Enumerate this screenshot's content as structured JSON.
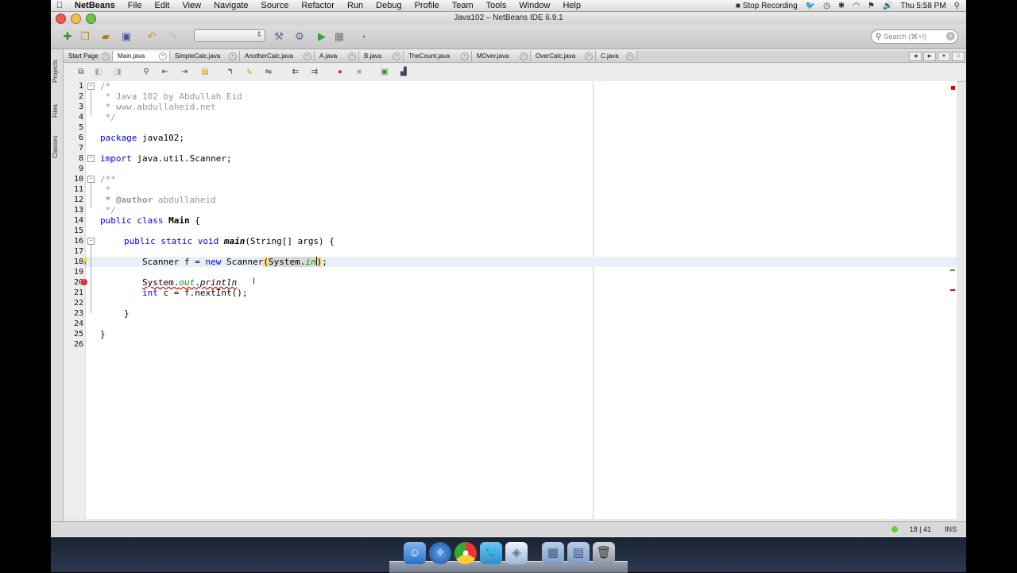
{
  "menubar": {
    "app_name": "NetBeans",
    "items": [
      "File",
      "Edit",
      "View",
      "Navigate",
      "Source",
      "Refactor",
      "Run",
      "Debug",
      "Profile",
      "Team",
      "Tools",
      "Window",
      "Help"
    ],
    "right": {
      "recording": "Stop Recording",
      "clock": "Thu 5:58 PM"
    }
  },
  "window": {
    "title": "Java102 – NetBeans IDE 6.9.1",
    "search_placeholder": "Search (⌘+I)"
  },
  "side_tabs": [
    "Projects",
    "Files",
    "Classes"
  ],
  "tabs": [
    {
      "label": "Start Page",
      "active": false
    },
    {
      "label": "Main.java",
      "active": true
    },
    {
      "label": "SimpleCalc.java",
      "active": false
    },
    {
      "label": "AnotherCalc.java",
      "active": false
    },
    {
      "label": "A.java",
      "active": false
    },
    {
      "label": "B.java",
      "active": false
    },
    {
      "label": "TheCount.java",
      "active": false
    },
    {
      "label": "MOver.java",
      "active": false
    },
    {
      "label": "OverCalc.java",
      "active": false
    },
    {
      "label": "C.java",
      "active": false
    }
  ],
  "code": {
    "line_numbers": [
      "1",
      "2",
      "3",
      "4",
      "5",
      "6",
      "7",
      "8",
      "9",
      "10",
      "11",
      "12",
      "13",
      "14",
      "15",
      "16",
      "17",
      "18",
      "19",
      "20",
      "21",
      "22",
      "23",
      "24",
      "25",
      "26"
    ],
    "l1": "/*",
    "l2": " * Java 102 by Abdullah Eid",
    "l3": " * www.abdullaheid.net",
    "l4": " */",
    "l6_kw": "package",
    "l6_rest": " java102;",
    "l8_kw": "import",
    "l8_rest": " java.util.Scanner;",
    "l10": "/**",
    "l11": " *",
    "l12_tag": " * @author",
    "l12_rest": " abdullaheid",
    "l13": " */",
    "l14_kw": "public class",
    "l14_name": " Main",
    "l14_rest": " {",
    "l16_kw": "public static void",
    "l16_fn": "main",
    "l16_rest": "(String[] args) {",
    "l18_a": "Scanner f = ",
    "l18_kw": "new",
    "l18_b": " Scanner",
    "l18_paren": "(",
    "l18_sys": "System.",
    "l18_in": "in",
    "l18_close": ")",
    "l18_end": ";",
    "l20_sys": "System.",
    "l20_out": "out",
    "l20_dot": ".",
    "l20_fn": "println",
    "l21_kw": "int",
    "l21_rest": " c = f.nextInt();",
    "l23": "}",
    "l25": "}"
  },
  "status": {
    "position": "18 | 41",
    "mode": "INS"
  }
}
